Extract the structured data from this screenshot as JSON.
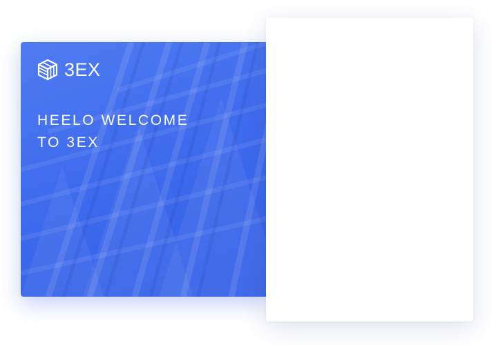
{
  "brand": {
    "logo_icon": "cube-logo-icon",
    "name": "3EX"
  },
  "hero": {
    "welcome_line_1": "HEELO WELCOME",
    "welcome_line_2": "TO 3EX",
    "background_color": "#3f6bed"
  },
  "form_card": {
    "background_color": "#ffffff"
  }
}
